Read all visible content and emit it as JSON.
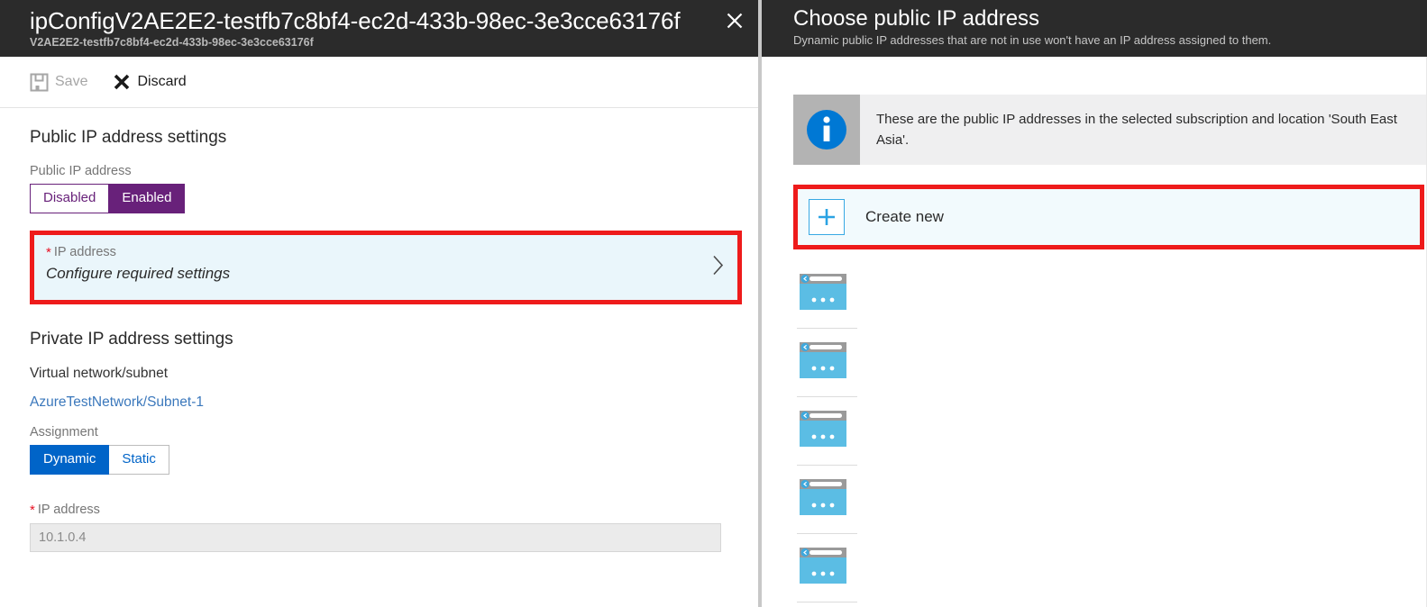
{
  "left_blade": {
    "title": "ipConfigV2AE2E2-testfb7c8bf4-ec2d-433b-98ec-3e3cce63176f",
    "subtitle": "V2AE2E2-testfb7c8bf4-ec2d-433b-98ec-3e3cce63176f",
    "close_icon": "close-icon",
    "toolbar": {
      "save_label": "Save",
      "save_icon": "save-floppy-icon",
      "save_enabled": false,
      "discard_label": "Discard",
      "discard_icon": "discard-x-icon",
      "discard_enabled": true
    },
    "public_section": {
      "heading": "Public IP address settings",
      "field_label": "Public IP address",
      "toggle": {
        "options": [
          "Disabled",
          "Enabled"
        ],
        "selected": "Enabled",
        "accent": "#68217A"
      },
      "picker": {
        "required_marker": "*",
        "label": "IP address",
        "value": "Configure required settings",
        "chevron_icon": "chevron-right-icon",
        "highlighted": true,
        "highlight_color": "#EE1B1B"
      }
    },
    "private_section": {
      "heading": "Private IP address settings",
      "vnet_label": "Virtual network/subnet",
      "vnet_value": "AzureTestNetwork/Subnet-1",
      "assignment_label": "Assignment",
      "assignment_toggle": {
        "options": [
          "Dynamic",
          "Static"
        ],
        "selected": "Dynamic",
        "accent": "#0064C8"
      },
      "ip_required_marker": "*",
      "ip_label": "IP address",
      "ip_value": "10.1.0.4"
    }
  },
  "right_blade": {
    "title": "Choose public IP address",
    "subtitle": "Dynamic public IP addresses that are not in use won't have an IP address assigned to them.",
    "info_banner": {
      "icon": "info-circle-icon",
      "text": "These are the public IP addresses in the selected subscription and location 'South East Asia'."
    },
    "create_new": {
      "label": "Create new",
      "icon": "plus-icon",
      "highlighted": true,
      "highlight_color": "#EE1B1B"
    },
    "ip_list": [
      {
        "icon": "public-ip-icon",
        "name": ""
      },
      {
        "icon": "public-ip-icon",
        "name": ""
      },
      {
        "icon": "public-ip-icon",
        "name": ""
      },
      {
        "icon": "public-ip-icon",
        "name": ""
      },
      {
        "icon": "public-ip-icon",
        "name": ""
      }
    ]
  }
}
